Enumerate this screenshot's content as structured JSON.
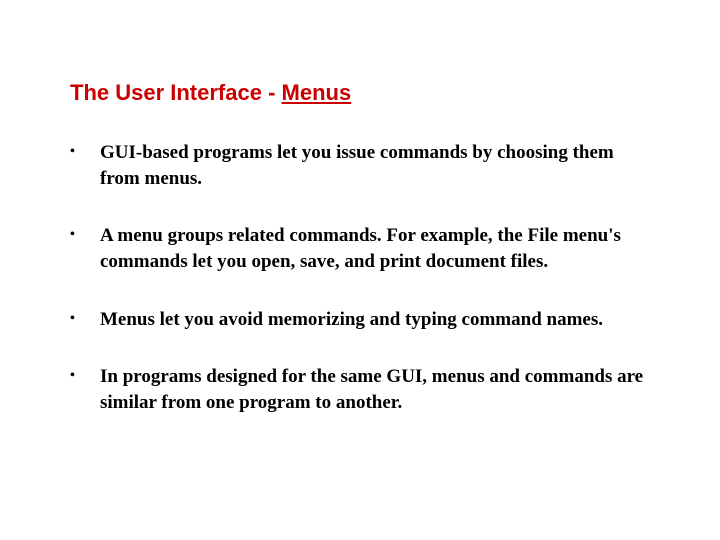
{
  "title": {
    "plain": "The User Interface - ",
    "underlined": "Menus"
  },
  "bullets": [
    "GUI-based programs let you issue commands by choosing them from menus.",
    "A menu groups related commands. For example, the File menu's commands let you open, save, and print document files.",
    "Menus let you avoid memorizing and typing command names.",
    "In programs designed for the same GUI, menus and commands are similar from one program to another."
  ]
}
